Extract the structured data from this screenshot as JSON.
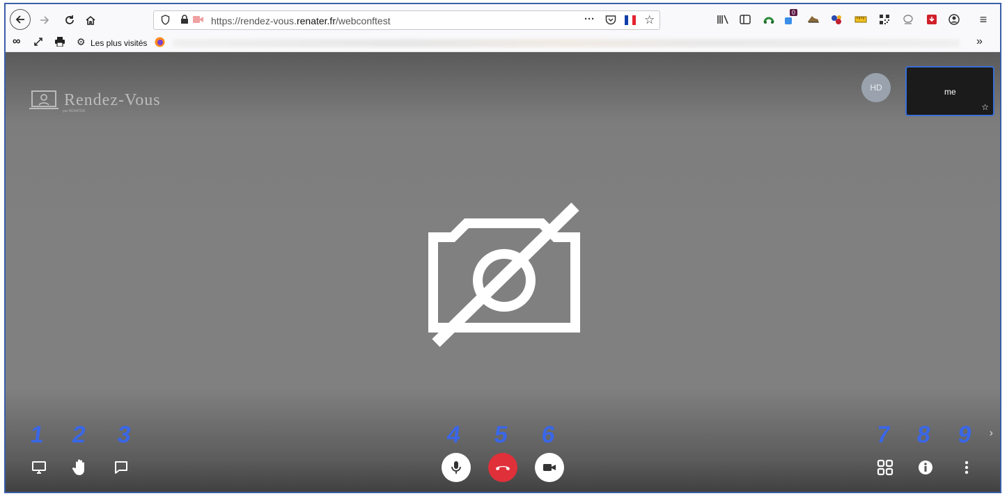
{
  "browser": {
    "url_prefix": "https://rendez-vous.",
    "url_domain": "renater.fr",
    "url_path": "/webconftest",
    "bookmarks_label": "Les plus visités",
    "notification_badge": "0",
    "page_actions_label": "···"
  },
  "meeting": {
    "logo_text": "Rendez-Vous",
    "logo_sub": "par RENATER",
    "avatar_initials": "HD",
    "thumbnail_name": "me"
  },
  "annotations": [
    "1",
    "2",
    "3",
    "4",
    "5",
    "6",
    "7",
    "8",
    "9"
  ],
  "colors": {
    "annotation": "#3a67e8",
    "hangup": "#e0303a",
    "thumb_border": "#3a6fd8"
  },
  "icons": {
    "left": [
      "screen-share-icon",
      "raise-hand-icon",
      "chat-icon"
    ],
    "center": [
      "microphone-icon",
      "hangup-icon",
      "camera-icon"
    ],
    "right": [
      "tile-view-icon",
      "info-icon",
      "more-icon"
    ]
  }
}
